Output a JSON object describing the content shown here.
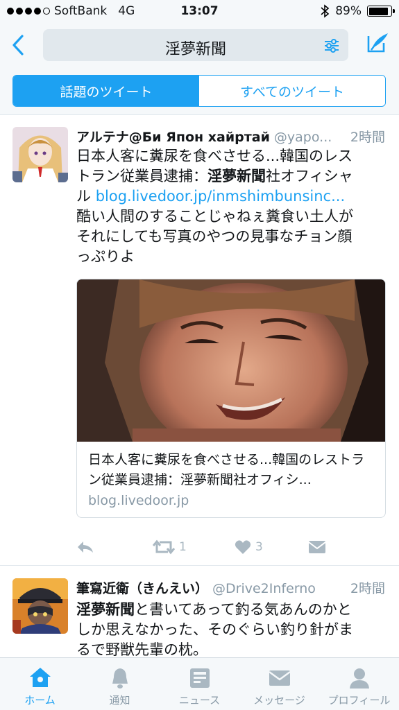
{
  "status_bar": {
    "carrier": "SoftBank",
    "network": "4G",
    "time": "13:07",
    "battery": "89%",
    "battery_level": 0.89
  },
  "nav": {
    "search_query": "淫夢新聞",
    "back_icon": "chevron-left-icon",
    "filter_icon": "sliders-icon",
    "compose_icon": "compose-icon"
  },
  "segments": {
    "top": "話題のツイート",
    "all": "すべてのツイート"
  },
  "tweets": [
    {
      "name": "アルテナ@Би Япон хайртай",
      "handle": "@yapo...",
      "ago": "2時間",
      "line1": "日本人客に糞尿を食べさせる...韓国のレス",
      "line2_pre": "トラン従業員逮捕：",
      "line2_hl": "淫夢新聞",
      "line2_post": "社オフィシャ",
      "line3_pre": "ル ",
      "line3_link": "blog.livedoor.jp/inmshimbunsinc...",
      "line4": "酷い人間のすることじゃねぇ糞食い土人が",
      "line5": "それにしても写真のやつの見事なチョン顔",
      "line6": "っぷりよ",
      "card": {
        "title": "日本人客に糞尿を食べさせる...韓国のレストラン従業員逮捕：淫夢新聞社オフィシ...",
        "domain": "blog.livedoor.jp"
      },
      "retweets": "1",
      "likes": "3"
    },
    {
      "name": "筆寫近衛（きんえい）",
      "handle": "@Drive2Inferno",
      "ago": "2時間",
      "line1_hl": "淫夢新聞",
      "line1_post": "と書いてあって釣る気あんのかと",
      "line2": "しか思えなかった、そのぐらい釣り針がま",
      "line3": "るで野獣先輩の枕。"
    }
  ],
  "tabbar": {
    "home": "ホーム",
    "notifications": "通知",
    "news": "ニュース",
    "messages": "メッセージ",
    "profile": "プロフィール"
  },
  "colors": {
    "accent": "#1da1f2",
    "muted": "#8899a6",
    "bar_bg": "#f5f8fa"
  }
}
